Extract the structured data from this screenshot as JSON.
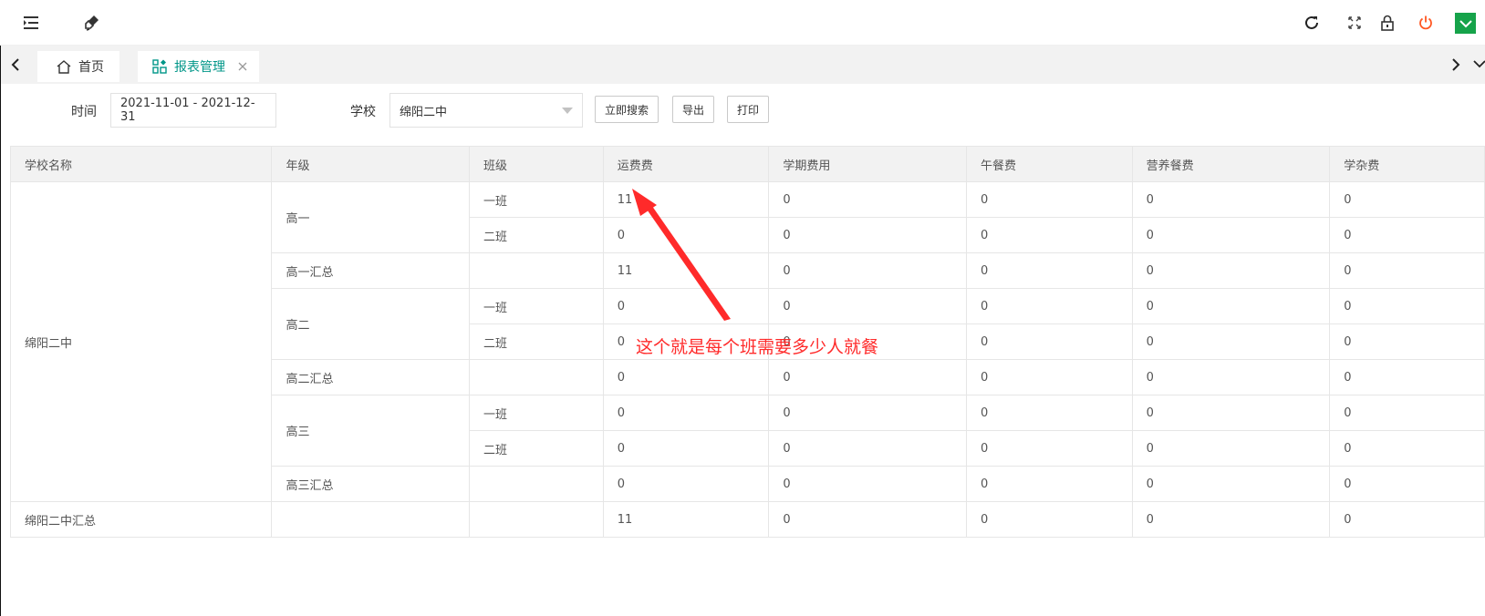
{
  "colors": {
    "accent": "#009688",
    "annotation": "#ff2a2a",
    "power": "#ff5722",
    "dropdown_green": "#16a34a"
  },
  "topbar": {
    "icons": [
      "menu-icon",
      "brush-icon",
      "refresh-icon",
      "fullscreen-icon",
      "lock-icon",
      "power-icon",
      "chevron-down-icon"
    ]
  },
  "tabs": [
    {
      "label": "首页",
      "icon": "home-icon"
    },
    {
      "label": "报表管理",
      "icon": "report-icon",
      "active": true
    }
  ],
  "filters": {
    "time_label": "时间",
    "time_value": "2021-11-01 - 2021-12-31",
    "school_label": "学校",
    "school_value": "绵阳二中"
  },
  "buttons": {
    "search": "立即搜索",
    "export": "导出",
    "print": "打印"
  },
  "table": {
    "headers": [
      "学校名称",
      "年级",
      "班级",
      "运费费",
      "学期费用",
      "午餐费",
      "营养餐费",
      "学杂费"
    ],
    "school": "绵阳二中",
    "grades": [
      "高一",
      "高二",
      "高三"
    ],
    "rows": [
      {
        "grade": "高一",
        "class": "一班",
        "values": [
          "11",
          "0",
          "0",
          "0",
          "0"
        ]
      },
      {
        "grade": "高一",
        "class": "二班",
        "values": [
          "0",
          "0",
          "0",
          "0",
          "0"
        ]
      },
      {
        "grade": "高一汇总",
        "class": "",
        "values": [
          "11",
          "0",
          "0",
          "0",
          "0"
        ]
      },
      {
        "grade": "高二",
        "class": "一班",
        "values": [
          "0",
          "0",
          "0",
          "0",
          "0"
        ]
      },
      {
        "grade": "高二",
        "class": "二班",
        "values": [
          "0",
          "0",
          "0",
          "0",
          "0"
        ]
      },
      {
        "grade": "高二汇总",
        "class": "",
        "values": [
          "0",
          "0",
          "0",
          "0",
          "0"
        ]
      },
      {
        "grade": "高三",
        "class": "一班",
        "values": [
          "0",
          "0",
          "0",
          "0",
          "0"
        ]
      },
      {
        "grade": "高三",
        "class": "二班",
        "values": [
          "0",
          "0",
          "0",
          "0",
          "0"
        ]
      },
      {
        "grade": "高三汇总",
        "class": "",
        "values": [
          "0",
          "0",
          "0",
          "0",
          "0"
        ]
      }
    ],
    "total_row": {
      "school": "绵阳二中汇总",
      "values": [
        "11",
        "0",
        "0",
        "0",
        "0"
      ]
    }
  },
  "annotation": "这个就是每个班需要多少人就餐"
}
